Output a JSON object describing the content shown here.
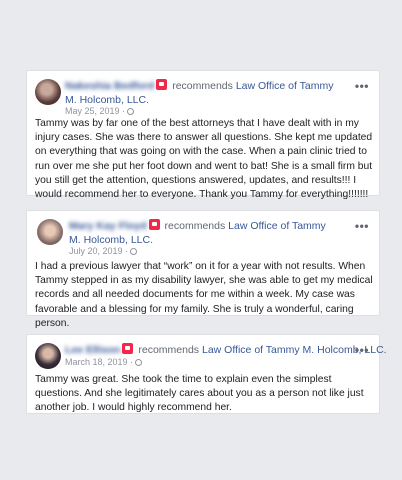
{
  "reviews": [
    {
      "reviewer": "Nakeshia Bedford",
      "recommends_label": "recommends",
      "page_name": "Law Office of Tammy M. Holcomb, LLC.",
      "date": "May 25, 2019",
      "more_label": "•••",
      "text": "Tammy was by far one of the best attorneys that I have dealt with in my injury cases. She was there to answer all questions. She kept me updated on everything that was going on with the case. When a pain clinic tried to run over me she put her foot down and went to bat! She is a small firm but you still get the attention, questions answered, updates, and results!!! I would recommend her to everyone. Thank you Tammy for everything!!!!!!!"
    },
    {
      "reviewer": "Mary Kay Floyd",
      "recommends_label": "recommends",
      "page_name": "Law Office of Tammy M. Holcomb, LLC.",
      "date": "July 20, 2019",
      "more_label": "•••",
      "text": "I had a previous lawyer that “work” on it for a year with not results. When Tammy stepped in as my disability lawyer, she was able to get my medical records and all needed documents for me within a week. My case was favorable and a blessing for my family. She is truly a wonderful, caring person."
    },
    {
      "reviewer": "Lee Ellison",
      "recommends_label": "recommends",
      "page_name": "Law Office of Tammy M. Holcomb, LLC.",
      "date": "March 18, 2019",
      "more_label": "•••",
      "text": "Tammy was great. She took the time to explain even the simplest questions. And she legitimately cares about you as a person not like just another job. I would highly recommend her."
    }
  ]
}
